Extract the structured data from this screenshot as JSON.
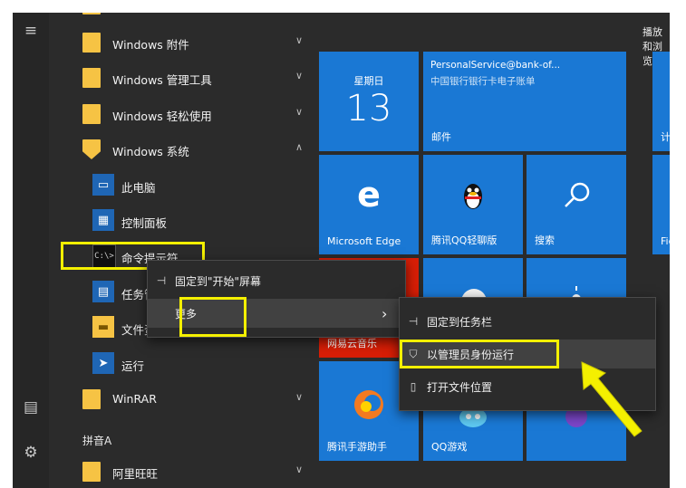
{
  "rail": {
    "menu_glyph": "≡",
    "files_glyph": "▤",
    "settings_glyph": "⚙"
  },
  "applist": {
    "folders": [
      {
        "label": "Windows 附件"
      },
      {
        "label": "Windows 管理工具"
      },
      {
        "label": "Windows 轻松使用"
      },
      {
        "label": "Windows 系统"
      }
    ],
    "system_apps": [
      {
        "label": "此电脑",
        "icon": "computer-icon"
      },
      {
        "label": "控制面板",
        "icon": "control-panel-icon"
      },
      {
        "label": "命令提示符",
        "icon": "command-prompt-icon"
      },
      {
        "label": "任务管理器",
        "icon": "task-manager-icon"
      },
      {
        "label": "文件资源管理器",
        "icon": "file-explorer-icon"
      },
      {
        "label": "运行",
        "icon": "run-icon"
      }
    ],
    "winrar": {
      "label": "WinRAR"
    },
    "section_letter": "拼音A",
    "aliwangwang": {
      "label": "阿里旺旺"
    },
    "cmd_glyph": "C:\\>"
  },
  "tiles": {
    "group_right_label": "播放和浏览",
    "calendar": {
      "weekday": "星期日",
      "day": "13"
    },
    "mail": {
      "sender": "PersonalService@bank-of...",
      "subject": "中国银行银行卡电子账单",
      "label": "邮件"
    },
    "calc_partial": {
      "label": "计算器"
    },
    "edge": {
      "label": "Microsoft Edge",
      "glyph": "e"
    },
    "qq_light": {
      "label": "腾讯QQ轻聊版"
    },
    "search": {
      "label": "搜索"
    },
    "fido_partial": {
      "label": "Fido"
    },
    "netease": {
      "label": "网易云音乐"
    },
    "tencent_helper": {
      "label": "腾讯手游助手"
    },
    "qq_game": {
      "label": "QQ游戏"
    }
  },
  "menu1": {
    "pin_start": "固定到\"开始\"屏幕",
    "more": "更多",
    "more_chevron": "›"
  },
  "menu2": {
    "pin_taskbar": "固定到任务栏",
    "run_admin": "以管理员身份运行",
    "open_location": "打开文件位置"
  },
  "colors": {
    "tile_blue": "#1a78d4",
    "highlight_yellow": "#f4f000",
    "folder_yellow": "#f6c344",
    "netease_red": "#d81e06"
  }
}
